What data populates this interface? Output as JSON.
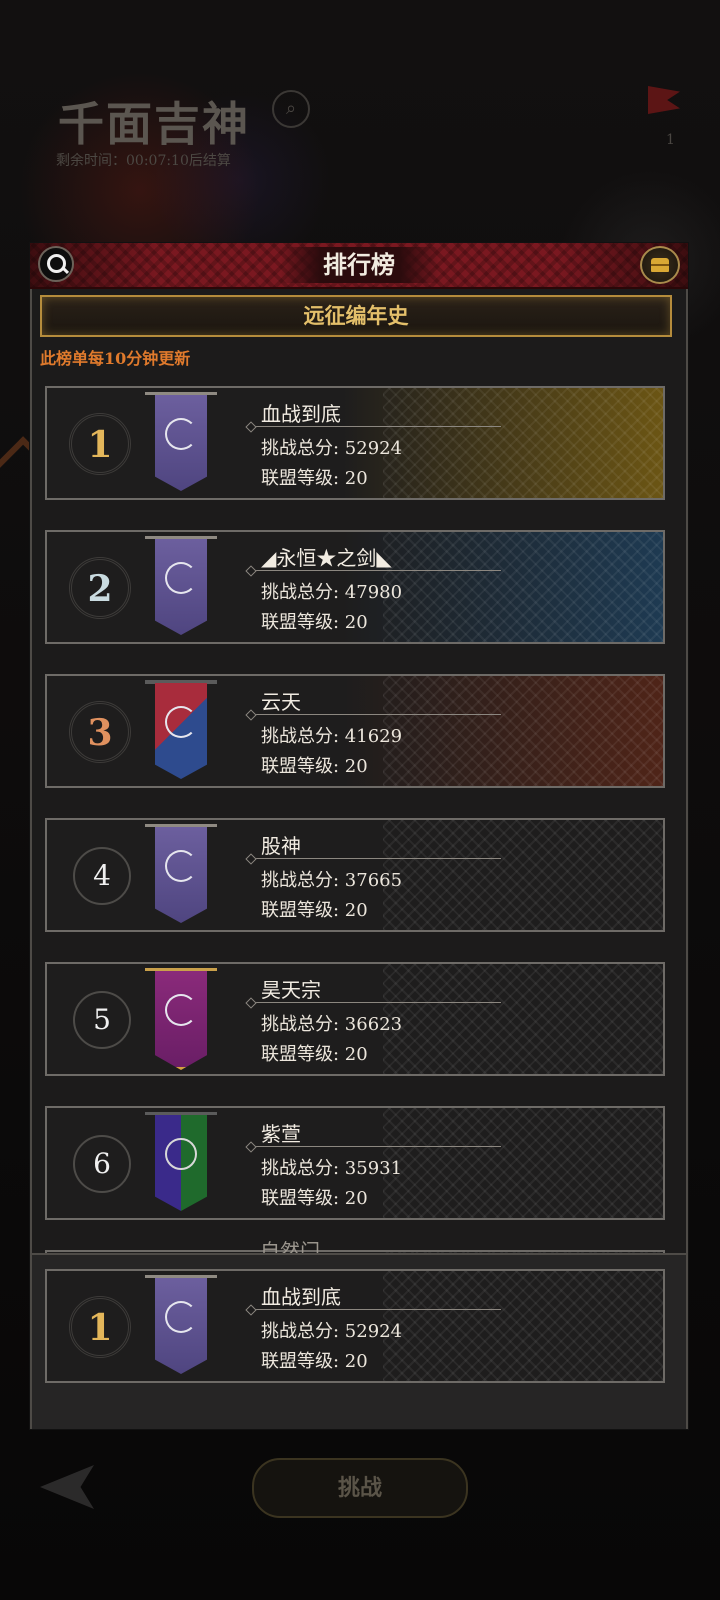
{
  "background": {
    "event_title": "千面吉神",
    "timer_text": "剩余时间：00:07:10后结算",
    "flag_count": "1",
    "challenge_button": "挑战"
  },
  "panel": {
    "title": "排行榜",
    "tab_label": "远征编年史",
    "update_notice": "此榜单每10分钟更新"
  },
  "rows": [
    {
      "rank": "1",
      "name": "血战到底",
      "score": "挑战总分: 52924",
      "level": "联盟等级: 20",
      "banner": "purple-crescent-banner",
      "tint": "#6b5514"
    },
    {
      "rank": "2",
      "name": "◢永恒★之剑◣",
      "score": "挑战总分: 47980",
      "level": "联盟等级: 20",
      "banner": "purple-crescent-banner",
      "tint": "#1e3a52"
    },
    {
      "rank": "3",
      "name": "云天",
      "score": "挑战总分: 41629",
      "level": "联盟等级: 20",
      "banner": "red-blue-banner",
      "tint": "#4f2418"
    },
    {
      "rank": "4",
      "name": "股神",
      "score": "挑战总分: 37665",
      "level": "联盟等级: 20",
      "banner": "purple-crescent-banner",
      "tint": ""
    },
    {
      "rank": "5",
      "name": "昊天宗",
      "score": "挑战总分: 36623",
      "level": "联盟等级: 20",
      "banner": "magenta-gold-banner",
      "tint": ""
    },
    {
      "rank": "6",
      "name": "紫萱",
      "score": "挑战总分: 35931",
      "level": "联盟等级: 20",
      "banner": "purple-green-tree-banner",
      "tint": ""
    }
  ],
  "partial_row_name": "自然门",
  "my_rank": {
    "rank": "1",
    "name": "血战到底",
    "score": "挑战总分: 52924",
    "level": "联盟等级: 20"
  },
  "colors": {
    "gold_rank": "#e3b65a",
    "silver_rank": "#c9dbe0",
    "bronze_rank": "#e0915f",
    "accent_orange": "#e07a2c"
  }
}
